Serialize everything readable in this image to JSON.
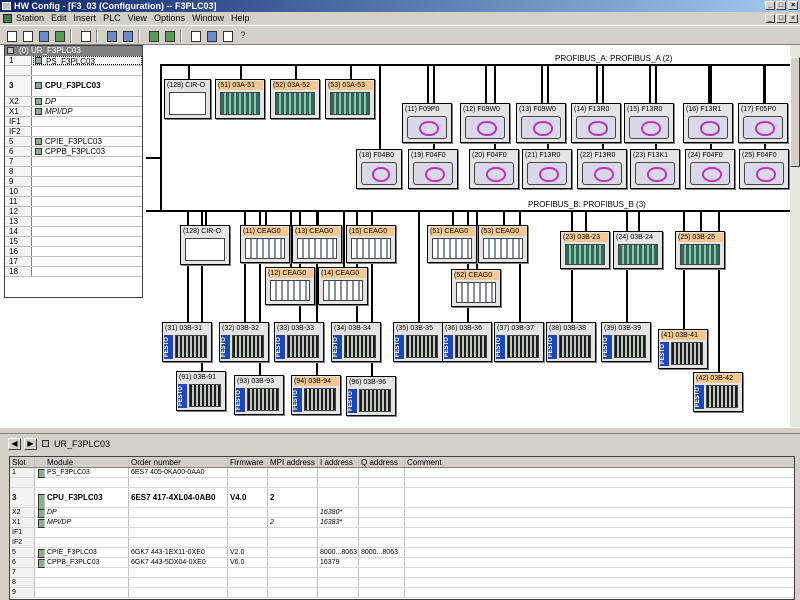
{
  "window": {
    "title": "HW Config - [F3_03 (Configuration) -- F3PLC03]"
  },
  "menu": [
    "Station",
    "Edit",
    "Insert",
    "PLC",
    "View",
    "Options",
    "Window",
    "Help"
  ],
  "rack": {
    "title": "(0) UR_F3PLC03",
    "rows": [
      {
        "slot": "1",
        "module": "PS_F3PLC03",
        "style": "sel"
      },
      {
        "slot": "",
        "module": "",
        "style": "gap"
      },
      {
        "slot": "3",
        "module": "CPU_F3PLC03",
        "style": "tall"
      },
      {
        "slot": "X2",
        "module": "DP",
        "style": "ital"
      },
      {
        "slot": "X1",
        "module": "MPI/DP",
        "style": "ital"
      },
      {
        "slot": "IF1",
        "module": "",
        "style": ""
      },
      {
        "slot": "IF2",
        "module": "",
        "style": ""
      },
      {
        "slot": "5",
        "module": "CPIE_F3PLC03",
        "style": ""
      },
      {
        "slot": "6",
        "module": "CPPB_F3PLC03",
        "style": ""
      },
      {
        "slot": "7",
        "module": "",
        "style": ""
      },
      {
        "slot": "8",
        "module": "",
        "style": ""
      },
      {
        "slot": "9",
        "module": "",
        "style": ""
      },
      {
        "slot": "10",
        "module": "",
        "style": ""
      },
      {
        "slot": "11",
        "module": "",
        "style": ""
      },
      {
        "slot": "12",
        "module": "",
        "style": ""
      },
      {
        "slot": "13",
        "module": "",
        "style": ""
      },
      {
        "slot": "14",
        "module": "",
        "style": ""
      },
      {
        "slot": "15",
        "module": "",
        "style": ""
      },
      {
        "slot": "16",
        "module": "",
        "style": ""
      },
      {
        "slot": "17",
        "module": "",
        "style": ""
      },
      {
        "slot": "18",
        "module": "",
        "style": ""
      }
    ]
  },
  "network": {
    "bus_a": "PROFIBUS_A: PROFIBUS_A (2)",
    "bus_b": "PROFIBUS_B: PROFIBUS_B (3)",
    "nodes": [
      {
        "label": "(128) CIR-O",
        "kind": "cir"
      },
      {
        "label": "(51) 03A-51",
        "kind": "grn orange"
      },
      {
        "label": "(52) 03A-52",
        "kind": "grn orange"
      },
      {
        "label": "(53) 03A-53",
        "kind": "grn orange"
      },
      {
        "label": "(11) F09P0",
        "kind": "drv"
      },
      {
        "label": "(12) F09W0",
        "kind": "drv"
      },
      {
        "label": "(13) F09W0",
        "kind": "drv"
      },
      {
        "label": "(14) F13R0",
        "kind": "drv"
      },
      {
        "label": "(15) F13R0",
        "kind": "drv"
      },
      {
        "label": "(16) F13R1",
        "kind": "drv"
      },
      {
        "label": "(17) F05P0",
        "kind": "drv"
      },
      {
        "label": "(18) F04B0",
        "kind": "drv"
      },
      {
        "label": "(19) F04F0",
        "kind": "drv"
      },
      {
        "label": "(20) F04F0",
        "kind": "drv"
      },
      {
        "label": "(21) F13R0",
        "kind": "drv"
      },
      {
        "label": "(22) F13R0",
        "kind": "drv"
      },
      {
        "label": "(23) F13K1",
        "kind": "drv"
      },
      {
        "label": "(24) F04F0",
        "kind": "drv"
      },
      {
        "label": "(25) F04F0",
        "kind": "drv"
      },
      {
        "label": "(128) CIR-O",
        "kind": "cir"
      },
      {
        "label": "(11) CEAG0",
        "kind": "cea orange"
      },
      {
        "label": "(13) CEAG0",
        "kind": "cea orange"
      },
      {
        "label": "(15) CEAG0",
        "kind": "cea orange"
      },
      {
        "label": "(12) CEAG0",
        "kind": "cea orange"
      },
      {
        "label": "(14) CEAG0",
        "kind": "cea orange"
      },
      {
        "label": "(51) CEAG0",
        "kind": "cea orange"
      },
      {
        "label": "(53) CEAG0",
        "kind": "cea orange"
      },
      {
        "label": "(52) CEAG0",
        "kind": "cea orange"
      },
      {
        "label": "(23) 03B-23",
        "kind": "grn orange"
      },
      {
        "label": "(24) 03B-24",
        "kind": "grn"
      },
      {
        "label": "(25) 03B-25",
        "kind": "grn orange"
      },
      {
        "label": "(31) 03B-31",
        "kind": "fest"
      },
      {
        "label": "(32) 03B-32",
        "kind": "fest"
      },
      {
        "label": "(33) 03B-33",
        "kind": "fest"
      },
      {
        "label": "(34) 03B-34",
        "kind": "fest"
      },
      {
        "label": "(35) 03B-35",
        "kind": "fest"
      },
      {
        "label": "(36) 03B-36",
        "kind": "fest"
      },
      {
        "label": "(37) 03B-37",
        "kind": "fest"
      },
      {
        "label": "(38) 03B-38",
        "kind": "fest"
      },
      {
        "label": "(39) 03B-39",
        "kind": "fest"
      },
      {
        "label": "(41) 03B-41",
        "kind": "fest orange"
      },
      {
        "label": "(91) 03B-91",
        "kind": "fest"
      },
      {
        "label": "(93) 03B-93",
        "kind": "fest"
      },
      {
        "label": "(94) 03B-94",
        "kind": "fest orange"
      },
      {
        "label": "(96) 03B-96",
        "kind": "fest"
      },
      {
        "label": "(42) 03B-42",
        "kind": "fest orange"
      }
    ]
  },
  "detail": {
    "rack_name": "UR_F3PLC03",
    "headers": [
      "Slot",
      "Module",
      "Order number",
      "Firmware",
      "MPI address",
      "I address",
      "Q address",
      "Comment"
    ],
    "rows": [
      {
        "slot": "1",
        "module": "PS_F3PLC03",
        "order": "6ES7 405-0KA00-0AA0",
        "fw": "",
        "mpi": "",
        "i": "",
        "q": "",
        "comment": "",
        "style": ""
      },
      {
        "slot": "",
        "module": "",
        "order": "",
        "fw": "",
        "mpi": "",
        "i": "",
        "q": "",
        "comment": "",
        "style": ""
      },
      {
        "slot": "3",
        "module": "CPU_F3PLC03",
        "order": "6ES7 417-4XL04-0AB0",
        "fw": "V4.0",
        "mpi": "2",
        "i": "",
        "q": "",
        "comment": "",
        "style": "tall"
      },
      {
        "slot": "X2",
        "module": "DP",
        "order": "",
        "fw": "",
        "mpi": "",
        "i": "16380*",
        "q": "",
        "comment": "",
        "style": "ital"
      },
      {
        "slot": "X1",
        "module": "MPI/DP",
        "order": "",
        "fw": "",
        "mpi": "2",
        "i": "16383*",
        "q": "",
        "comment": "",
        "style": "ital"
      },
      {
        "slot": "IF1",
        "module": "",
        "order": "",
        "fw": "",
        "mpi": "",
        "i": "",
        "q": "",
        "comment": "",
        "style": ""
      },
      {
        "slot": "IF2",
        "module": "",
        "order": "",
        "fw": "",
        "mpi": "",
        "i": "",
        "q": "",
        "comment": "",
        "style": ""
      },
      {
        "slot": "5",
        "module": "CPIE_F3PLC03",
        "order": "6GK7 443-1EX11-0XE0",
        "fw": "V2.0",
        "mpi": "",
        "i": "8000...8063",
        "q": "8000...8063",
        "comment": "",
        "style": ""
      },
      {
        "slot": "6",
        "module": "CPPB_F3PLC03",
        "order": "6GK7 443-5DX04-0XE0",
        "fw": "V6.0",
        "mpi": "",
        "i": "16379",
        "q": "",
        "comment": "",
        "style": ""
      },
      {
        "slot": "7",
        "module": "",
        "order": "",
        "fw": "",
        "mpi": "",
        "i": "",
        "q": "",
        "comment": "",
        "style": ""
      },
      {
        "slot": "8",
        "module": "",
        "order": "",
        "fw": "",
        "mpi": "",
        "i": "",
        "q": "",
        "comment": "",
        "style": ""
      },
      {
        "slot": "9",
        "module": "",
        "order": "",
        "fw": "",
        "mpi": "",
        "i": "",
        "q": "",
        "comment": "",
        "style": ""
      }
    ]
  }
}
